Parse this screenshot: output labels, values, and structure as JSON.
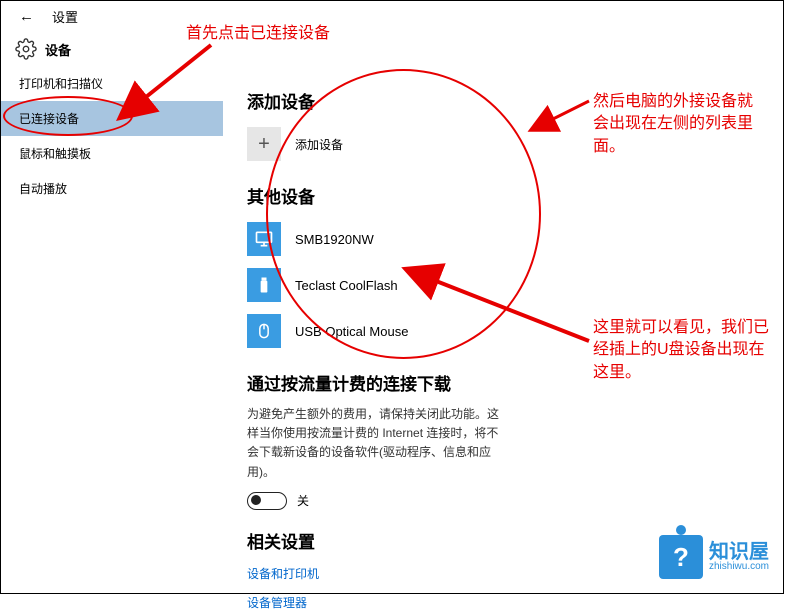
{
  "header": {
    "settings_label": "设置"
  },
  "device_header": {
    "title": "设备"
  },
  "sidebar": {
    "items": [
      {
        "label": "打印机和扫描仪"
      },
      {
        "label": "已连接设备"
      },
      {
        "label": "鼠标和触摸板"
      },
      {
        "label": "自动播放"
      }
    ]
  },
  "content": {
    "add_section_title": "添加设备",
    "add_device_label": "添加设备",
    "other_section_title": "其他设备",
    "devices": [
      {
        "label": "SMB1920NW"
      },
      {
        "label": "Teclast CoolFlash"
      },
      {
        "label": "USB Optical Mouse"
      }
    ],
    "metered_title": "通过按流量计费的连接下载",
    "metered_desc": "为避免产生额外的费用，请保持关闭此功能。这样当你使用按流量计费的 Internet 连接时，将不会下载新设备的设备软件(驱动程序、信息和应用)。",
    "toggle_state": "关",
    "related_title": "相关设置",
    "links": [
      {
        "label": "设备和打印机"
      },
      {
        "label": "设备管理器"
      }
    ]
  },
  "annotations": {
    "top": "首先点击已连接设备",
    "right1": "然后电脑的外接设备就会出现在左侧的列表里面。",
    "right2": "这里就可以看见，我们已经插上的U盘设备出现在这里。"
  },
  "watermark": {
    "name": "知识屋",
    "url": "zhishiwu.com",
    "q": "?"
  }
}
